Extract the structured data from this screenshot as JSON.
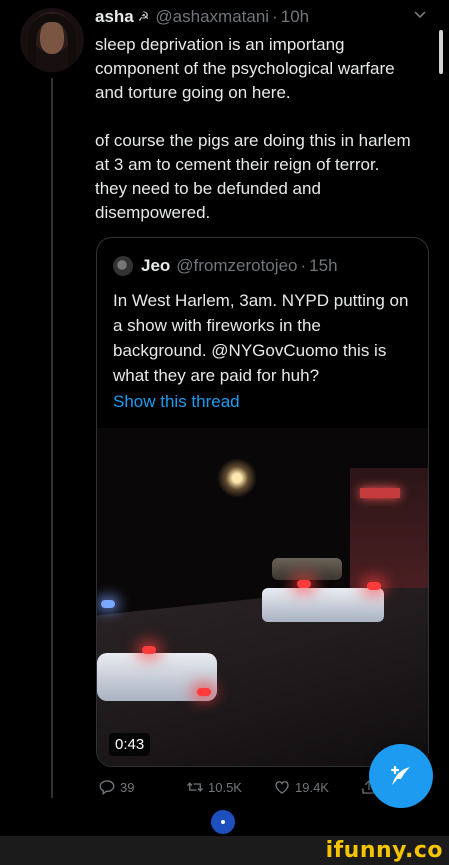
{
  "tweet": {
    "name": "asha",
    "flag": "☭",
    "handle": "@ashaxmatani",
    "separator": "·",
    "time": "10h",
    "paragraphs": [
      "sleep deprivation is an importang component of the psychological warfare and torture going on here.",
      "of course the pigs are doing this in harlem at 3 am to cement their reign of terror. they need to be defunded and disempowered."
    ]
  },
  "quote": {
    "name": "Jeo",
    "handle": "@fromzerotojeo",
    "separator": "·",
    "time": "15h",
    "text": "In West Harlem, 3am. NYPD putting on a show with fireworks in the background. @NYGovCuomo this is what they are paid for huh?",
    "show_thread": "Show this thread",
    "video_duration": "0:43"
  },
  "actions": {
    "replies": "39",
    "retweets": "10.5K",
    "likes": "19.4K"
  },
  "icons": {
    "reply": "reply-icon",
    "retweet": "retweet-icon",
    "like": "heart-icon",
    "share": "share-icon",
    "compose": "compose-icon",
    "caret": "chevron-down-icon"
  },
  "colors": {
    "accent": "#1d9bf0",
    "muted": "#71767b",
    "watermark": "#f4c400"
  },
  "watermark": "ifunny.co"
}
